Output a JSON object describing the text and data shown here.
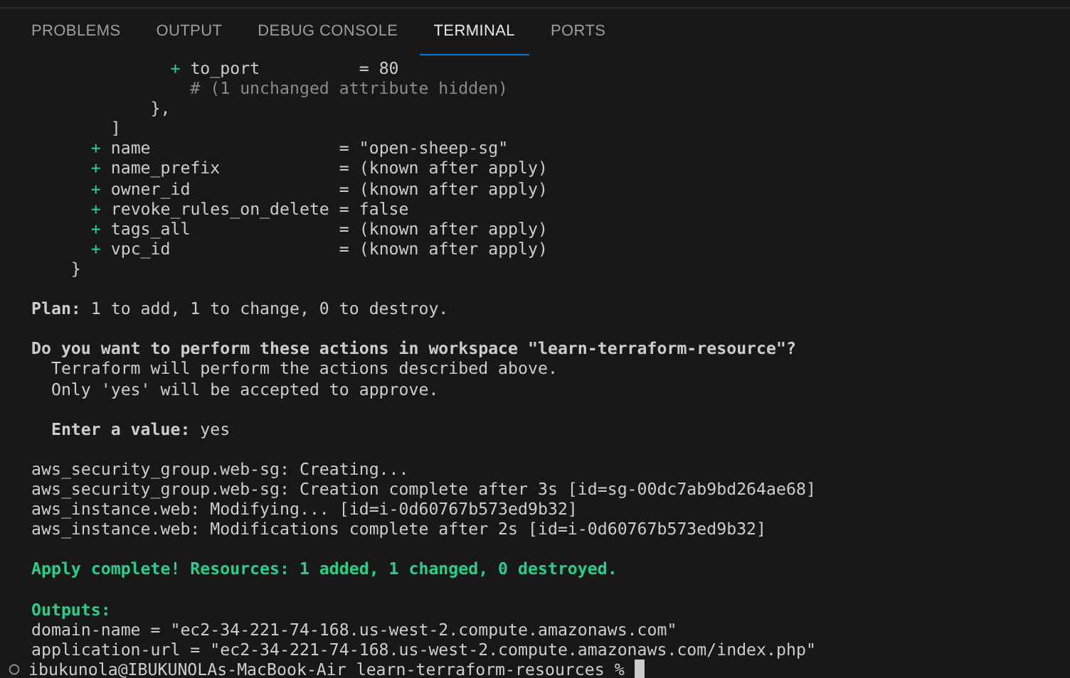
{
  "tabs": [
    {
      "label": "PROBLEMS",
      "selected": false
    },
    {
      "label": "OUTPUT",
      "selected": false
    },
    {
      "label": "DEBUG CONSOLE",
      "selected": false
    },
    {
      "label": "TERMINAL",
      "selected": true
    },
    {
      "label": "PORTS",
      "selected": false
    }
  ],
  "terminal": {
    "blocks": [
      {
        "lines": [
          {
            "kind": "added",
            "text": "              + to_port          = 80"
          },
          {
            "kind": "comment",
            "text": "                # (1 unchanged attribute hidden)"
          },
          {
            "kind": "plain",
            "text": "            },"
          },
          {
            "kind": "plain",
            "text": "        ]"
          },
          {
            "kind": "added",
            "text": "      + name                   = \"open-sheep-sg\""
          },
          {
            "kind": "added",
            "text": "      + name_prefix            = (known after apply)"
          },
          {
            "kind": "added",
            "text": "      + owner_id               = (known after apply)"
          },
          {
            "kind": "added",
            "text": "      + revoke_rules_on_delete = false"
          },
          {
            "kind": "added",
            "text": "      + tags_all               = (known after apply)"
          },
          {
            "kind": "added",
            "text": "      + vpc_id                 = (known after apply)"
          },
          {
            "kind": "plain",
            "text": "    }"
          }
        ]
      },
      {
        "lines": [
          {
            "kind": "plain",
            "text": "**Plan:** 1 to add, 1 to change, 0 to destroy."
          }
        ]
      },
      {
        "lines": [
          {
            "kind": "bold",
            "text": "Do you want to perform these actions in workspace \"learn-terraform-resource\"?"
          },
          {
            "kind": "plain",
            "text": "  Terraform will perform the actions described above."
          },
          {
            "kind": "plain",
            "text": "  Only 'yes' will be accepted to approve."
          }
        ]
      },
      {
        "lines": [
          {
            "kind": "plain",
            "text": "  **Enter a value:** yes"
          }
        ]
      },
      {
        "lines": [
          {
            "kind": "plain",
            "text": "aws_security_group.web-sg: Creating..."
          },
          {
            "kind": "plain",
            "text": "aws_security_group.web-sg: Creation complete after 3s [id=sg-00dc7ab9bd264ae68]"
          },
          {
            "kind": "plain",
            "text": "aws_instance.web: Modifying... [id=i-0d60767b573ed9b32]"
          },
          {
            "kind": "plain",
            "text": "aws_instance.web: Modifications complete after 2s [id=i-0d60767b573ed9b32]"
          }
        ]
      },
      {
        "lines": [
          {
            "kind": "success",
            "text": "Apply complete! Resources: 1 added, 1 changed, 0 destroyed."
          }
        ]
      },
      {
        "lines": [
          {
            "kind": "success",
            "text": "Outputs:"
          },
          {
            "kind": "plain",
            "text": "domain-name = \"ec2-34-221-74-168.us-west-2.compute.amazonaws.com\""
          },
          {
            "kind": "plain",
            "text": "application-url = \"ec2-34-221-74-168.us-west-2.compute.amazonaws.com/index.php\""
          },
          {
            "kind": "prompt",
            "text": "ibukunola@IBUKUNOLAs-MacBook-Air learn-terraform-resources %"
          }
        ]
      }
    ]
  }
}
